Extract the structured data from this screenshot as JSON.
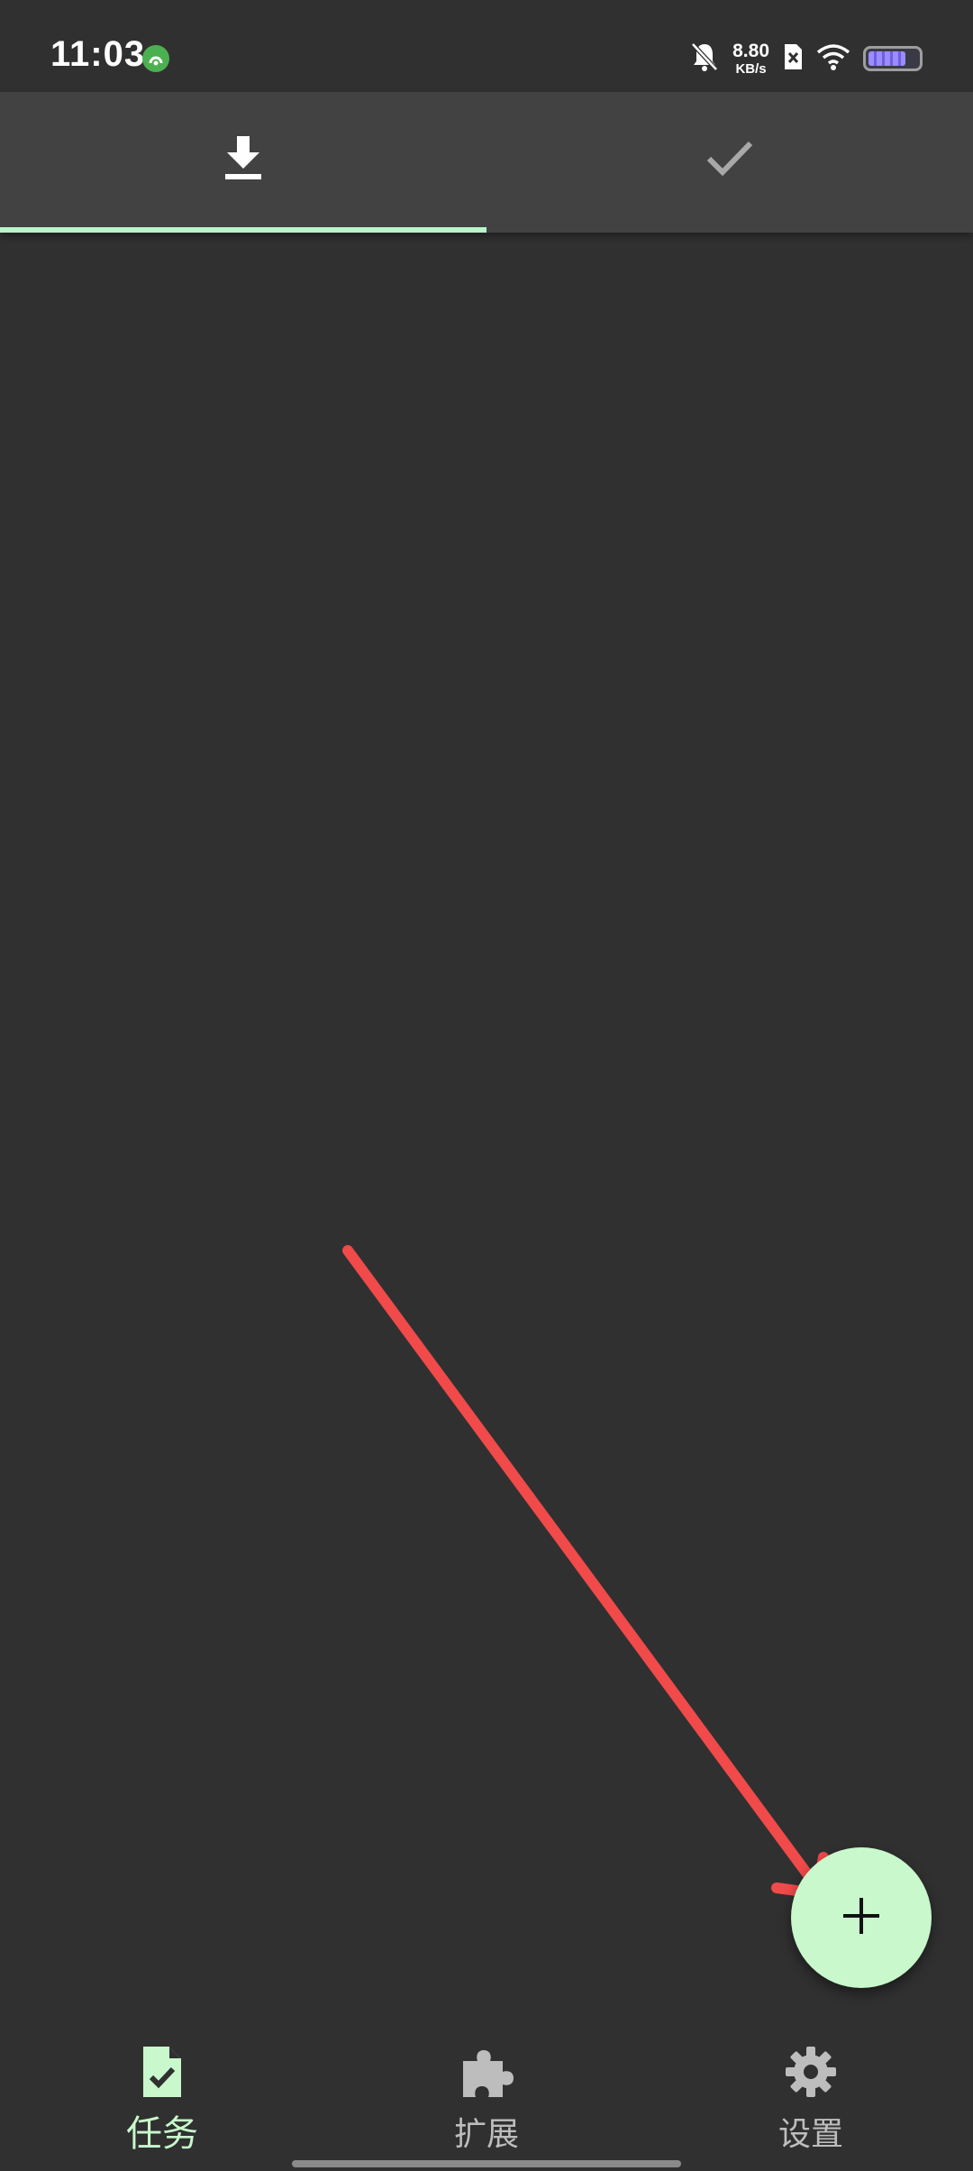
{
  "status_bar": {
    "time": "11:03",
    "net_speed_value": "8.80",
    "net_speed_unit": "KB/s",
    "icons": [
      "app-notification-icon",
      "bell-muted-icon",
      "sim-disabled-icon",
      "wifi-icon",
      "battery-icon"
    ],
    "battery_level": 0.75
  },
  "tabs": [
    {
      "icon": "download-icon",
      "selected": true
    },
    {
      "icon": "check-icon",
      "selected": false
    }
  ],
  "fab": {
    "icon": "plus-icon"
  },
  "annotation": {
    "icon": "red-arrow-annotation"
  },
  "bottom_nav": {
    "items": [
      {
        "label": "任务",
        "icon": "task-file-check-icon",
        "selected": true
      },
      {
        "label": "扩展",
        "icon": "puzzle-icon",
        "selected": false
      },
      {
        "label": "设置",
        "icon": "gear-icon",
        "selected": false
      }
    ]
  },
  "colors": {
    "background": "#303030",
    "tab_bar": "#424242",
    "accent": "#c8f8cb",
    "indicator": "#b9f6ca",
    "annotation": "#f04a4a",
    "inactive": "#bdbdbd"
  }
}
